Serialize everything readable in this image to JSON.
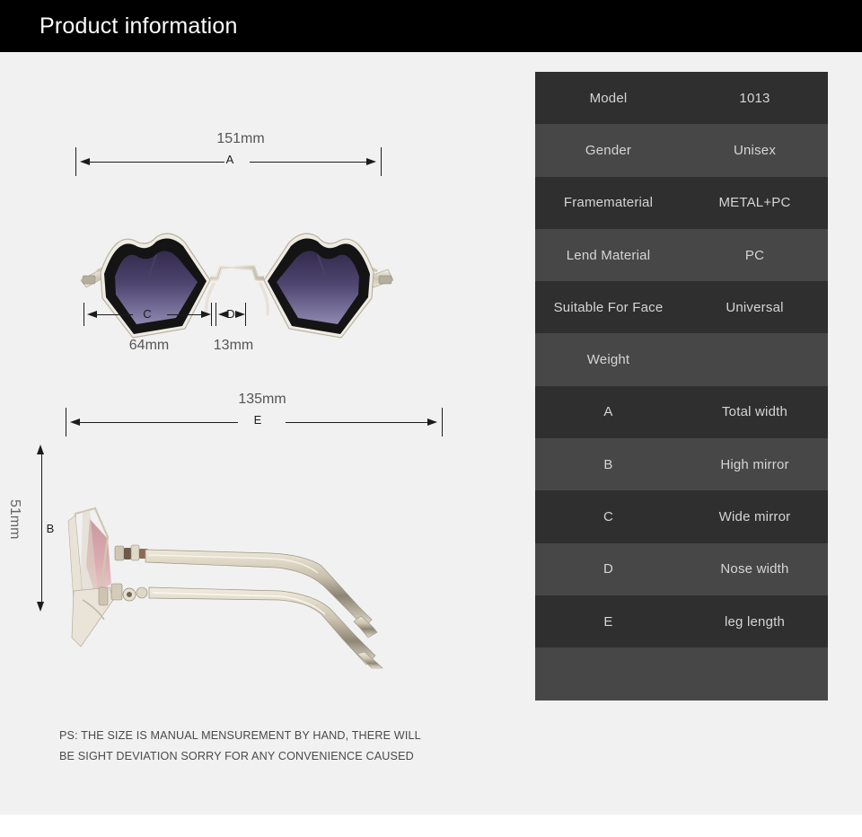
{
  "header": {
    "title": "Product information"
  },
  "dimensions": {
    "a": {
      "value": "151mm",
      "letter": "A"
    },
    "b": {
      "value": "51mm",
      "letter": "B"
    },
    "c": {
      "value": "64mm",
      "letter": "C"
    },
    "d": {
      "value": "13mm",
      "letter": "D"
    },
    "e": {
      "value": "135mm",
      "letter": "E"
    }
  },
  "note": {
    "line1": "PS: THE SIZE IS MANUAL MENSUREMENT BY HAND, THERE WILL",
    "line2": "BE SIGHT DEVIATION SORRY FOR ANY CONVENIENCE CAUSED"
  },
  "spec_table": {
    "rows": [
      {
        "key": "Model",
        "value": "1013"
      },
      {
        "key": "Gender",
        "value": "Unisex"
      },
      {
        "key": "Framematerial",
        "value": "METAL+PC"
      },
      {
        "key": "Lend Material",
        "value": "PC"
      },
      {
        "key": "Suitable For Face",
        "value": "Universal"
      },
      {
        "key": "Weight",
        "value": ""
      },
      {
        "key": "A",
        "value": "Total width"
      },
      {
        "key": "B",
        "value": "High mirror"
      },
      {
        "key": "C",
        "value": "Wide mirror"
      },
      {
        "key": "D",
        "value": "Nose width"
      },
      {
        "key": "E",
        "value": "leg length"
      },
      {
        "key": "",
        "value": ""
      }
    ]
  },
  "colors": {
    "header_bg": "#000000",
    "page_bg": "#f1f1f1",
    "row_dark": "#2f2f2f",
    "row_light": "#474747",
    "text_light": "#d5d5d5",
    "lens_top": "#3a3152",
    "lens_bottom": "#8781ab",
    "frame_black": "#111111",
    "metal": "#d8d2c2"
  }
}
